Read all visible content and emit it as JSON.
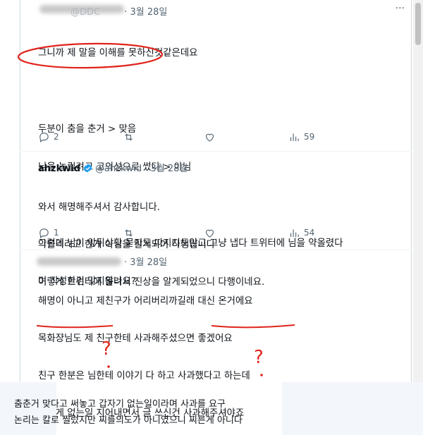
{
  "tweets": [
    {
      "handle": "@DDC",
      "date": "· 3월 28일",
      "lines": [
        "그니까 제 말을 이해를 못하신것같은데요",
        "",
        "두분이 춤을 춘거 > 맞음",
        "님을 놀릴려고 고의성으로 썼다 > 아님",
        "",
        "그런데 님이 앞뒤상황 묻지도 따지지도않고 그냥 냅다 트위터에 님을 약올렸다",
        "며 작성한건 맞지않나요?"
      ],
      "replies": "2",
      "views": "59"
    },
    {
      "name": "ahzkwid",
      "handle": "@ahzkwid",
      "date": "· 3월 28일",
      "lines": [
        "와서 해명해주셔서 감사합니다.",
        "약올리려고 한게 아님을 알게되어 다행입니다",
        "이렇게 트위터에 올려서 진상을 알게되었으니 다행이네요."
      ],
      "replies": "1",
      "views": "54"
    },
    {
      "date": "· 3월 28일",
      "lines": [
        "해명이 아니고 제친구가 어리버리까길래 대신 온거에요",
        "목화쟝님도 제 친구한테 사과해주셨으면 좋겠어요",
        "친구 한분은 님한테 이야기 다 하고 사과했다고 하는데",
        "이렇게 없는일 지어내면서 글 쓰신건 사과해주셔야죠"
      ]
    }
  ],
  "annotations": {
    "question_mark": "?"
  },
  "caption": {
    "line1": "춤춘거 맞다고 써놓고 갑자기 없는일이라며 사과를 요구",
    "line2": "논리는 칼로 찔렀지만 찌를의도가 아니였으니 찌른게 아니다"
  },
  "colors": {
    "annotation_red": "#e0241c",
    "verified_blue": "#1d9bf0",
    "muted_text": "#536471"
  },
  "icons": [
    "reply-icon",
    "retweet-icon",
    "like-icon",
    "views-icon",
    "more-icon",
    "verified-badge-icon"
  ]
}
